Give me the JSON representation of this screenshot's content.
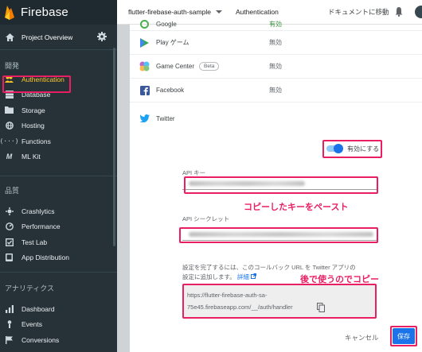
{
  "brand": {
    "name": "Firebase"
  },
  "sidebar": {
    "overview": "Project Overview",
    "sections": [
      {
        "title": "開発",
        "items": [
          "Authentication",
          "Database",
          "Storage",
          "Hosting",
          "Functions",
          "ML Kit"
        ]
      },
      {
        "title": "品質",
        "items": [
          "Crashlytics",
          "Performance",
          "Test Lab",
          "App Distribution"
        ]
      },
      {
        "title": "アナリティクス",
        "items": [
          "Dashboard",
          "Events",
          "Conversions"
        ]
      }
    ],
    "active": "Authentication"
  },
  "topbar": {
    "project": "flutter-firebase-auth-sample",
    "page": "Authentication",
    "docs": "ドキュメントに移動"
  },
  "providers": [
    {
      "name": "Google",
      "status": "有効"
    },
    {
      "name": "Play ゲーム",
      "status": "無効"
    },
    {
      "name": "Game Center",
      "badge": "Beta",
      "status": "無効"
    },
    {
      "name": "Facebook",
      "status": "無効"
    }
  ],
  "dialog": {
    "provider": "Twitter",
    "toggle_label": "有効にする",
    "api_key_label": "API キー",
    "api_secret_label": "API シークレット",
    "description": "設定を完了するには、このコールバック URL を Twitter アプリの設定に追加します。",
    "details_link": "詳細",
    "callback_url_line1": "https://flutter-firebase-auth-sa-",
    "callback_url_line2": "75e45.firebaseapp.com/__/auth/handler",
    "cancel": "キャンセル",
    "save": "保存"
  },
  "annotations": {
    "paste": "コピーしたキーをペースト",
    "copy_later": "後で使うのでコピー"
  },
  "colors": {
    "highlight": "#e91e63",
    "accent": "#1a73e8",
    "sidebar": "#263238",
    "active": "#ffca28"
  }
}
